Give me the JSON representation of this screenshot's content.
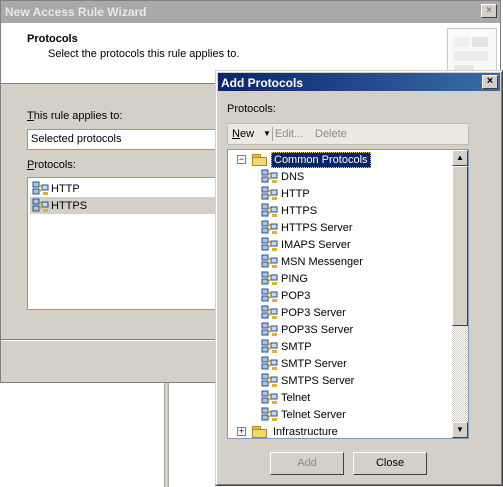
{
  "wizard": {
    "title": "New Access Rule Wizard",
    "close_symbol": "×",
    "heading": "Protocols",
    "subheading": "Select the protocols this rule applies to.",
    "applies_label_prefix": "T",
    "applies_label_rest": "his rule applies to:",
    "applies_value": "Selected protocols",
    "protocols_label_prefix": "P",
    "protocols_label_rest": "rotocols:",
    "protocols": [
      {
        "name": "HTTP",
        "icon": "protocol-icon"
      },
      {
        "name": "HTTPS",
        "icon": "protocol-icon"
      }
    ]
  },
  "dialog": {
    "title": "Add Protocols",
    "close_symbol": "×",
    "protocols_label": "Protocols:",
    "toolbar": {
      "new_prefix": "N",
      "new_rest": "ew",
      "new_arrow": "▼",
      "edit_label": "Edit...",
      "delete_label": "Delete"
    },
    "tree": {
      "common_folder": {
        "label": "Common Protocols",
        "expander": "−"
      },
      "common_items": [
        "DNS",
        "HTTP",
        "HTTPS",
        "HTTPS Server",
        "IMAPS Server",
        "MSN Messenger",
        "PING",
        "POP3",
        "POP3 Server",
        "POP3S Server",
        "SMTP",
        "SMTP Server",
        "SMTPS Server",
        "Telnet",
        "Telnet Server"
      ],
      "infra_folder": {
        "label": "Infrastructure",
        "expander": "+"
      }
    },
    "scroll_up": "▲",
    "scroll_down": "▼",
    "add_label": "Add",
    "close_label": "Close"
  }
}
